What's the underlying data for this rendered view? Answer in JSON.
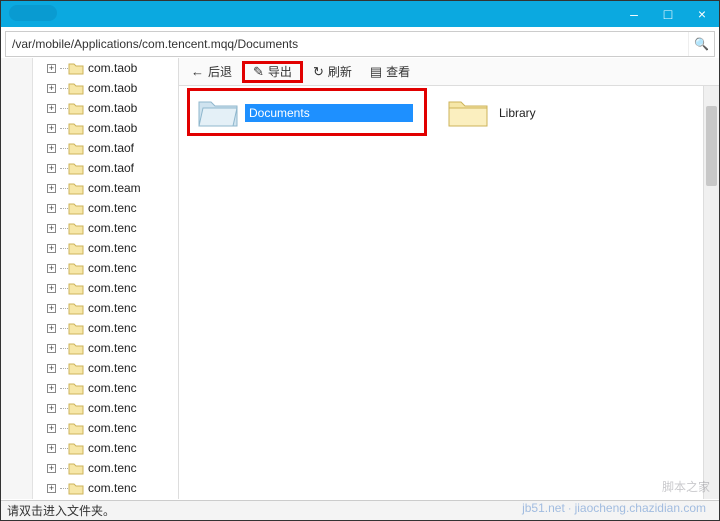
{
  "title_bar": {
    "min": "–",
    "max": "□",
    "close": "×"
  },
  "address": {
    "path": "/var/mobile/Applications/com.tencent.mqq/Documents"
  },
  "toolbar": {
    "back": "后退",
    "export": "导出",
    "refresh": "刷新",
    "view": "查看"
  },
  "tree": {
    "items": [
      "com.taob",
      "com.taob",
      "com.taob",
      "com.taob",
      "com.taof",
      "com.taof",
      "com.team",
      "com.tenc",
      "com.tenc",
      "com.tenc",
      "com.tenc",
      "com.tenc",
      "com.tenc",
      "com.tenc",
      "com.tenc",
      "com.tenc",
      "com.tenc",
      "com.tenc",
      "com.tenc",
      "com.tenc",
      "com.tenc",
      "com.tenc"
    ]
  },
  "content": {
    "folders": [
      {
        "name": "Documents",
        "selected": true
      },
      {
        "name": "Library",
        "selected": false
      }
    ]
  },
  "status": {
    "text": "请双击进入文件夹。"
  },
  "watermark": {
    "line1": "脚本之家",
    "line2": "jb51.net",
    "line3": "jiaocheng.chazidian.com"
  }
}
